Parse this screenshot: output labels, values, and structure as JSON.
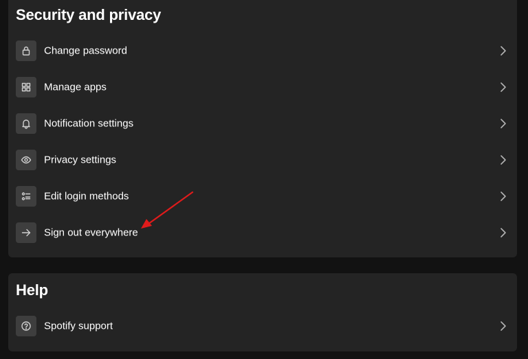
{
  "security": {
    "title": "Security and privacy",
    "items": [
      {
        "label": "Change password",
        "icon": "lock-icon"
      },
      {
        "label": "Manage apps",
        "icon": "grid-icon"
      },
      {
        "label": "Notification settings",
        "icon": "bell-icon"
      },
      {
        "label": "Privacy settings",
        "icon": "eye-icon"
      },
      {
        "label": "Edit login methods",
        "icon": "list-icon"
      },
      {
        "label": "Sign out everywhere",
        "icon": "arrow-right-icon"
      }
    ]
  },
  "help": {
    "title": "Help",
    "items": [
      {
        "label": "Spotify support",
        "icon": "question-icon"
      }
    ]
  },
  "colors": {
    "background": "#121212",
    "card": "#242424",
    "icon_box": "#3e3e3e",
    "annotation_arrow": "#e01b1b"
  }
}
